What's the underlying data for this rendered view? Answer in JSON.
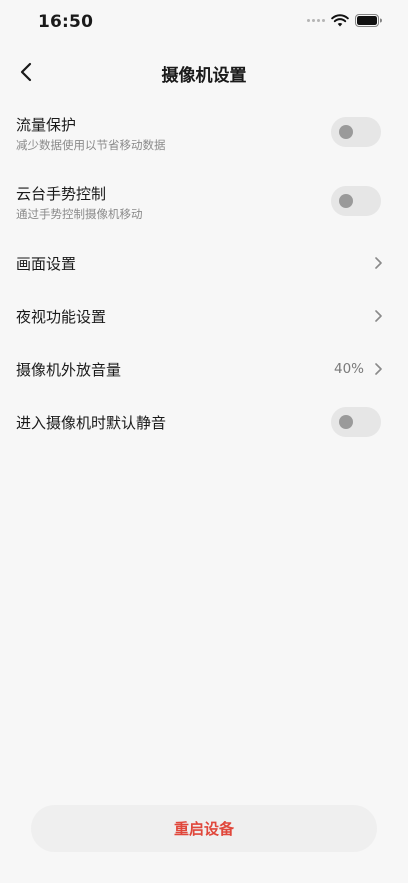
{
  "status_bar": {
    "time": "16:50",
    "icons": [
      "signal-dots-icon",
      "wifi-icon",
      "battery-icon"
    ]
  },
  "nav": {
    "back_icon": "chevron-left-icon",
    "title": "摄像机设置"
  },
  "settings": {
    "traffic_protection": {
      "title": "流量保护",
      "subtitle": "减少数据使用以节省移动数据",
      "enabled": false
    },
    "ptz_gesture": {
      "title": "云台手势控制",
      "subtitle": "通过手势控制摄像机移动",
      "enabled": false
    },
    "image_settings": {
      "title": "画面设置"
    },
    "night_vision": {
      "title": "夜视功能设置"
    },
    "speaker_volume": {
      "title": "摄像机外放音量",
      "value": "40%"
    },
    "default_mute": {
      "title": "进入摄像机时默认静音",
      "enabled": false
    }
  },
  "restart_button": {
    "label": "重启设备"
  },
  "colors": {
    "background": "#f7f7f7",
    "danger": "#e0473b",
    "toggle_off_track": "#e6e6e6",
    "toggle_off_knob": "#9a9a9a"
  }
}
